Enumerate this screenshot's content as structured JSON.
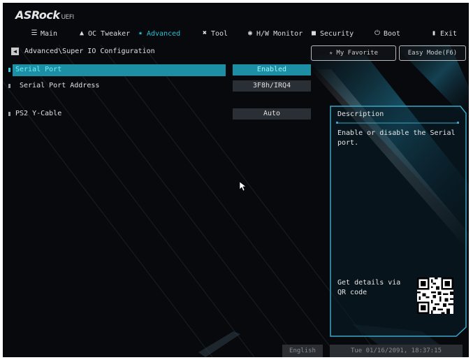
{
  "brand": {
    "name": "ASRock",
    "suffix": "UEFI"
  },
  "nav": [
    {
      "label": "Main",
      "icon": "list-icon",
      "active": false
    },
    {
      "label": "OC Tweaker",
      "icon": "rocket-icon",
      "active": false
    },
    {
      "label": "Advanced",
      "icon": "star-icon",
      "active": true
    },
    {
      "label": "Tool",
      "icon": "tool-icon",
      "active": false
    },
    {
      "label": "H/W Monitor",
      "icon": "monitor-icon",
      "active": false
    },
    {
      "label": "Security",
      "icon": "shield-icon",
      "active": false
    },
    {
      "label": "Boot",
      "icon": "power-icon",
      "active": false
    },
    {
      "label": "Exit",
      "icon": "exit-icon",
      "active": false
    }
  ],
  "breadcrumb": "Advanced\\Super IO Configuration",
  "buttons": {
    "favorite": "My Favorite",
    "easy_mode": "Easy Mode(F6)"
  },
  "settings": [
    {
      "label": "Serial Port",
      "value": "Enabled",
      "selected": true
    },
    {
      "label": "Serial Port Address",
      "value": "3F8h/IRQ4",
      "selected": false
    },
    {
      "label": "PS2 Y-Cable",
      "value": "Auto",
      "selected": false
    }
  ],
  "description": {
    "title": "Description",
    "text": "Enable or disable the Serial port.",
    "qr_label": "Get details via QR code"
  },
  "footer": {
    "language": "English",
    "datetime": "Tue 01/16/2091, 18:37:15"
  },
  "colors": {
    "accent": "#27c4d8",
    "selected_bg": "#1d8fa5",
    "background": "#07090c"
  }
}
